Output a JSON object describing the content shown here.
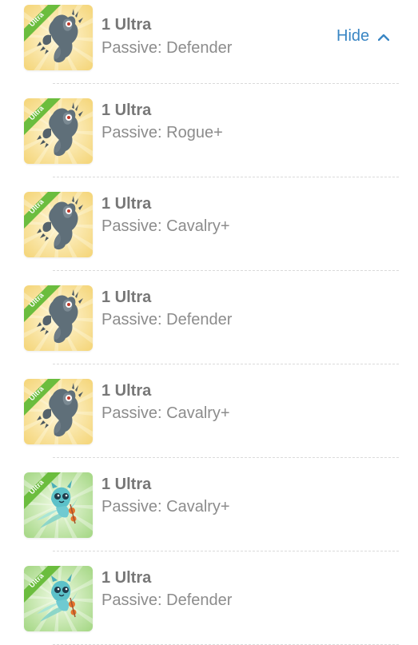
{
  "hide_button": {
    "label": "Hide",
    "icon": "chevron-up-icon",
    "color": "#3a86c4"
  },
  "badge_colors": {
    "ribbon": "#6bbd3e",
    "gold_background": "#f7dc8a",
    "green_background": "#bde3a0"
  },
  "items": [
    {
      "title": "1 Ultra",
      "passive": "Passive: Defender",
      "badge": "Ultra",
      "art": "grey-dragon",
      "background": "gold"
    },
    {
      "title": "1 Ultra",
      "passive": "Passive: Rogue+",
      "badge": "Ultra",
      "art": "grey-dragon",
      "background": "gold"
    },
    {
      "title": "1 Ultra",
      "passive": "Passive: Cavalry+",
      "badge": "Ultra",
      "art": "grey-dragon",
      "background": "gold"
    },
    {
      "title": "1 Ultra",
      "passive": "Passive: Defender",
      "badge": "Ultra",
      "art": "grey-dragon",
      "background": "gold"
    },
    {
      "title": "1 Ultra",
      "passive": "Passive: Cavalry+",
      "badge": "Ultra",
      "art": "grey-dragon",
      "background": "gold"
    },
    {
      "title": "1 Ultra",
      "passive": "Passive: Cavalry+",
      "badge": "Ultra",
      "art": "teal-spirit",
      "background": "green"
    },
    {
      "title": "1 Ultra",
      "passive": "Passive: Defender",
      "badge": "Ultra",
      "art": "teal-spirit",
      "background": "green"
    }
  ]
}
